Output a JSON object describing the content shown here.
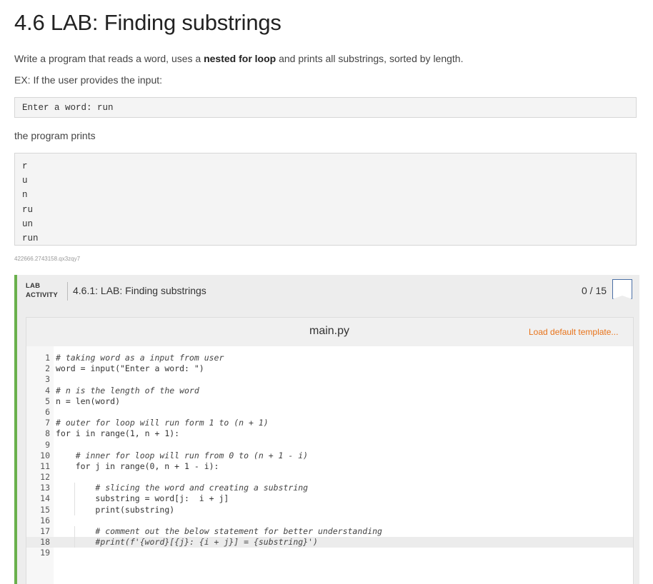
{
  "heading": "4.6 LAB: Finding substrings",
  "description": {
    "before": "Write a program that reads a word, uses a ",
    "bold": "nested for loop",
    "after": " and prints all substrings, sorted by length."
  },
  "example_intro": "EX: If the user provides the input:",
  "input_example": "Enter a word: run",
  "output_intro": "the program prints",
  "output_lines": [
    "r",
    "u",
    "n",
    "ru",
    "un",
    "run"
  ],
  "hash_id": "422666.2743158.qx3zqy7",
  "lab": {
    "tag_line1": "LAB",
    "tag_line2": "ACTIVITY",
    "title": "4.6.1: LAB: Finding substrings",
    "score": "0 / 15"
  },
  "editor": {
    "filename": "main.py",
    "load_default": "Load default template...",
    "active_line": 18,
    "lines": [
      {
        "num": "1",
        "indent": 0,
        "comment": true,
        "text": "# taking word as a input from user"
      },
      {
        "num": "2",
        "indent": 0,
        "comment": false,
        "text": "word = input(\"Enter a word: \")"
      },
      {
        "num": "3",
        "indent": 0,
        "comment": false,
        "text": ""
      },
      {
        "num": "4",
        "indent": 0,
        "comment": true,
        "text": "# n is the length of the word"
      },
      {
        "num": "5",
        "indent": 0,
        "comment": false,
        "text": "n = len(word)"
      },
      {
        "num": "6",
        "indent": 0,
        "comment": false,
        "text": ""
      },
      {
        "num": "7",
        "indent": 0,
        "comment": true,
        "text": "# outer for loop will run form 1 to (n + 1)"
      },
      {
        "num": "8",
        "indent": 0,
        "comment": false,
        "text": "for i in range(1, n + 1):"
      },
      {
        "num": "9",
        "indent": 0,
        "comment": false,
        "text": ""
      },
      {
        "num": "10",
        "indent": 1,
        "comment": true,
        "text": "# inner for loop will run from 0 to (n + 1 - i)"
      },
      {
        "num": "11",
        "indent": 1,
        "comment": false,
        "text": "for j in range(0, n + 1 - i):"
      },
      {
        "num": "12",
        "indent": 0,
        "comment": false,
        "text": ""
      },
      {
        "num": "13",
        "indent": 2,
        "comment": true,
        "text": "# slicing the word and creating a substring"
      },
      {
        "num": "14",
        "indent": 2,
        "comment": false,
        "text": "substring = word[j:  i + j]"
      },
      {
        "num": "15",
        "indent": 2,
        "comment": false,
        "text": "print(substring)"
      },
      {
        "num": "16",
        "indent": 0,
        "comment": false,
        "text": ""
      },
      {
        "num": "17",
        "indent": 2,
        "comment": true,
        "text": "# comment out the below statement for better understanding"
      },
      {
        "num": "18",
        "indent": 2,
        "comment": true,
        "text": "#print(f'{word}[{j}: {i + j}] = {substring}')"
      },
      {
        "num": "19",
        "indent": 0,
        "comment": false,
        "text": ""
      }
    ]
  }
}
